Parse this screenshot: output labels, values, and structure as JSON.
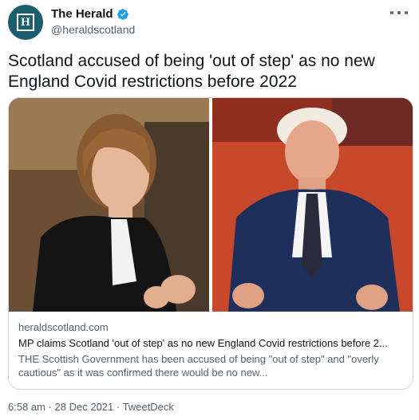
{
  "account": {
    "display_name": "The Herald",
    "handle": "@heraldscotland",
    "avatar_letter": "H",
    "verified": true
  },
  "tweet": {
    "text": "Scotland accused of being 'out of step' as no new England Covid restrictions before 2022"
  },
  "card": {
    "domain": "heraldscotland.com",
    "title": "MP claims Scotland 'out of step' as no new England Covid restrictions before 2...",
    "description": "THE Scottish Government has been accused of being \"out of step\" and \"overly cautious\" as it was confirmed there would be no new..."
  },
  "meta": {
    "time": "6:58 am",
    "separator1": " · ",
    "date": "28 Dec 2021",
    "separator2": " · ",
    "source": "TweetDeck"
  },
  "colors": {
    "avatar_bg": "#1b5f6e",
    "verified_blue": "#1d9bf0",
    "secondary_text": "#536471",
    "primary_text": "#0f1419",
    "card_border": "#cfd9de"
  },
  "icons": {
    "verified": "verified-badge-icon",
    "more": "more-options-icon"
  }
}
